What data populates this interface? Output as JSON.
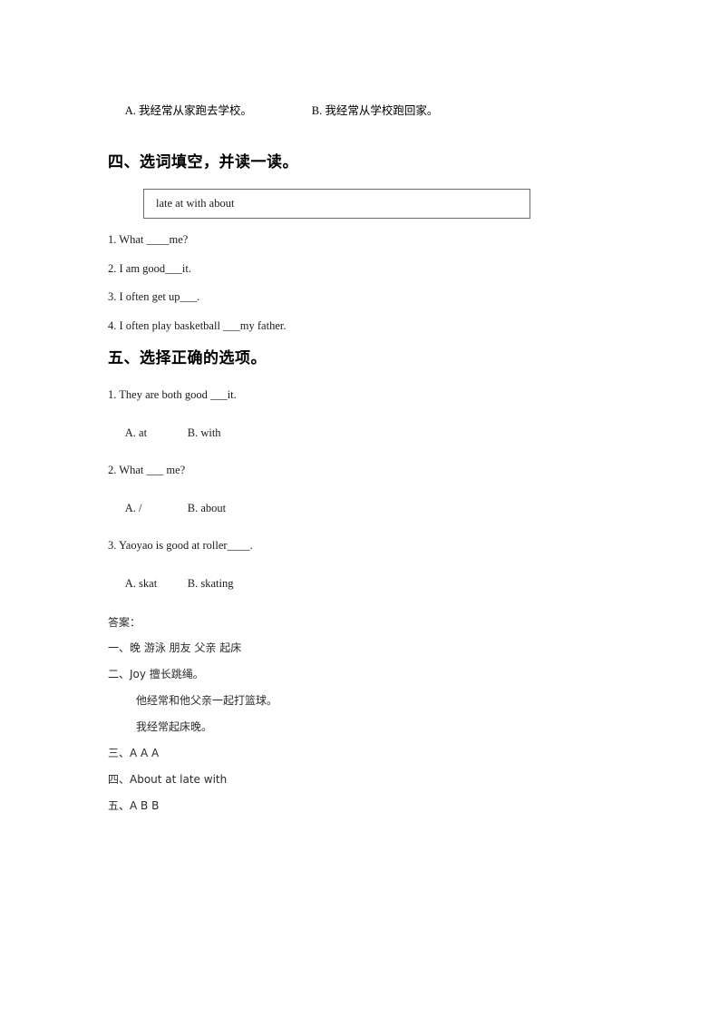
{
  "document": {
    "top_options": {
      "option_a": "A. 我经常从家跑去学校。",
      "option_b": "B. 我经常从学校跑回家。"
    },
    "section_four": {
      "heading": "四、选词填空，并读一读。",
      "word_bank": "late at with about",
      "questions": [
        "1. What ____me?",
        "2. I am good___it.",
        "3. I often get up___.",
        "4. I often play basketball ___my father."
      ]
    },
    "section_five": {
      "heading": "五、选择正确的选项。",
      "questions": [
        {
          "prompt": "1. They are both good ___it.",
          "option_a": "A. at",
          "option_b": "B. with"
        },
        {
          "prompt": "2. What ___ me?",
          "option_a": "A. /",
          "option_b": "B. about"
        },
        {
          "prompt": "3. Yaoyao is good at roller____.",
          "option_a": "A. skat",
          "option_b": "B. skating"
        }
      ]
    },
    "answer_key": {
      "heading": "答案：",
      "lines": [
        "一、晚 游泳 朋友 父亲 起床",
        "二、Joy 擅长跳绳。",
        "他经常和他父亲一起打篮球。",
        "我经常起床晚。",
        "三、A A A",
        "四、About at late with",
        "五、A B B"
      ]
    }
  }
}
